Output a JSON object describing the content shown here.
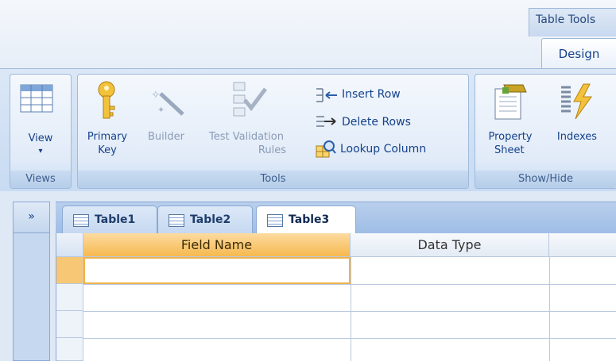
{
  "contextual": {
    "title": "Table Tools",
    "tab": "Design"
  },
  "groups": {
    "views": {
      "label": "Views",
      "view_button": "View"
    },
    "tools": {
      "label": "Tools",
      "primary_key": [
        "Primary",
        "Key"
      ],
      "builder": "Builder",
      "test_validation": [
        "Test Validation",
        "Rules"
      ],
      "insert_rows": "Insert Row",
      "delete_rows": "Delete Rows",
      "lookup_column": "Lookup Column"
    },
    "show_hide": {
      "label": "Show/Hide",
      "property_sheet": [
        "Property",
        "Sheet"
      ],
      "indexes": "Indexes"
    }
  },
  "nav": {
    "toggle": "»"
  },
  "tabs": [
    "Table1",
    "Table2",
    "Table3"
  ],
  "grid": {
    "columns": [
      "Field Name",
      "Data Type"
    ],
    "rows": [
      [
        "",
        ""
      ],
      [
        "",
        ""
      ],
      [
        "",
        ""
      ],
      [
        "",
        ""
      ]
    ]
  },
  "colors": {
    "accent": "#f6b94f",
    "ribbon": "#c8dbf2",
    "text": "#15428b"
  }
}
